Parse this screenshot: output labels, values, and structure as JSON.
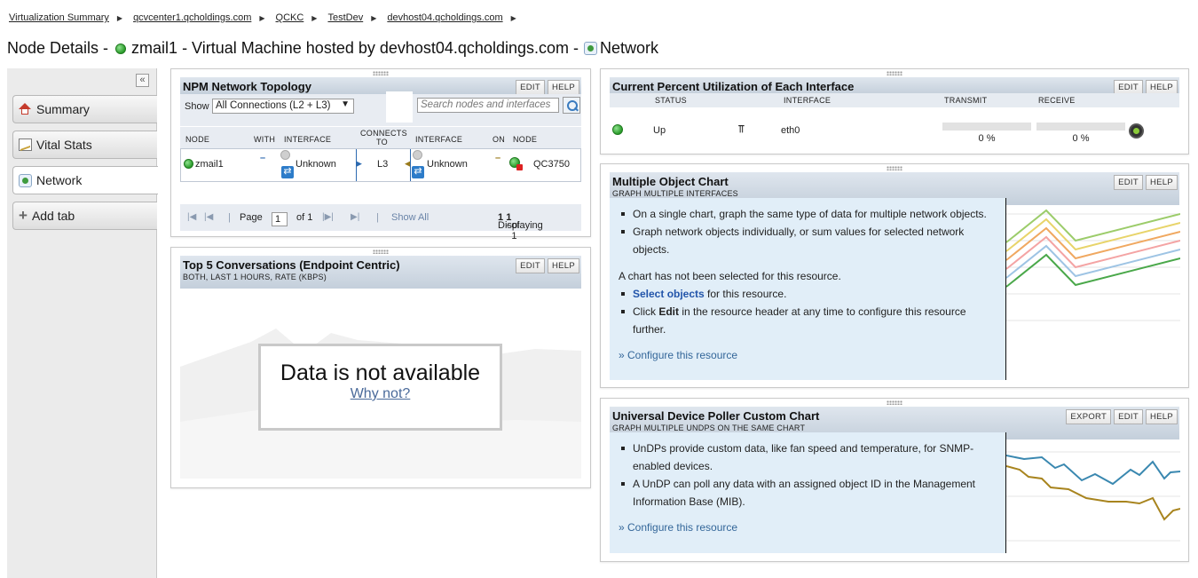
{
  "breadcrumb": [
    "Virtualization Summary",
    "qcvcenter1.qcholdings.com",
    "QCKC",
    "TestDev",
    "devhost04.qcholdings.com"
  ],
  "title": {
    "prefix": "Node Details -",
    "node": "zmail1",
    "middle": "- Virtual Machine hosted by devhost04.qcholdings.com -",
    "tab": "Network"
  },
  "tabs": [
    {
      "label": "Summary",
      "icon": "home-icon"
    },
    {
      "label": "Vital Stats",
      "icon": "chart-icon"
    },
    {
      "label": "Network",
      "icon": "network-icon",
      "active": true
    },
    {
      "label": "Add tab",
      "icon": "plus-icon"
    }
  ],
  "buttons": {
    "edit": "EDIT",
    "help": "HELP",
    "export": "EXPORT"
  },
  "topology": {
    "title": "NPM Network Topology",
    "show_label": "Show",
    "show_value": "All Connections (L2 + L3)",
    "search_placeholder": "Search nodes and interfaces",
    "columns": {
      "node": "NODE",
      "with": "WITH",
      "interface": "INTERFACE",
      "connects_1": "CONNECTS",
      "connects_2": "TO",
      "interface2": "INTERFACE",
      "on": "ON",
      "node2": "NODE"
    },
    "row": {
      "node": "zmail1",
      "interface": "Unknown",
      "connects_to": "L3",
      "interface2": "Unknown",
      "node2": "QC3750"
    },
    "pager": {
      "page_label": "Page",
      "page_value": "1",
      "of_label": "of 1",
      "show_all": "Show All",
      "displaying": "Displaying",
      "range_from": "1",
      "range_sep": "-",
      "range_to": "1",
      "of_total": "of 1"
    }
  },
  "conversations": {
    "title": "Top 5 Conversations (Endpoint Centric)",
    "subtitle": "BOTH, LAST 1 HOURS, RATE (KBPS)",
    "no_data": "Data is not available",
    "why_not": "Why not?"
  },
  "utilization": {
    "title": "Current Percent Utilization of Each Interface",
    "columns": {
      "status": "STATUS",
      "interface": "INTERFACE",
      "transmit": "TRANSMIT",
      "receive": "RECEIVE"
    },
    "row": {
      "status": "Up",
      "interface": "eth0",
      "transmit": "0 %",
      "receive": "0 %"
    }
  },
  "multi_chart": {
    "title": "Multiple Object Chart",
    "subtitle": "GRAPH MULTIPLE INTERFACES",
    "bullets": [
      "On a single chart, graph the same type of data for multiple network objects.",
      "Graph network objects individually, or sum values for selected network objects."
    ],
    "not_selected": "A chart has not been selected for this resource.",
    "select_link": "Select objects",
    "select_rest": " for this resource.",
    "click_word": "Click ",
    "edit_word": "Edit",
    "click_rest": " in the resource header at any time to configure this resource further.",
    "configure": "» Configure this resource",
    "line_colors": [
      "#9ccc6a",
      "#e8d46a",
      "#f0a860",
      "#f4a4a4",
      "#9ec4e4",
      "#4aa84a"
    ]
  },
  "udp_chart": {
    "title": "Universal Device Poller Custom Chart",
    "subtitle": "GRAPH MULTIPLE UNDPS ON THE SAME CHART",
    "bullets": [
      "UnDPs provide custom data, like fan speed and temperature, for SNMP-enabled devices.",
      "A UnDP can poll any data with an assigned object ID in the Management Information Base (MIB)."
    ],
    "configure": "» Configure this resource",
    "line_colors": [
      "#3a88b0",
      "#a8841e"
    ]
  }
}
